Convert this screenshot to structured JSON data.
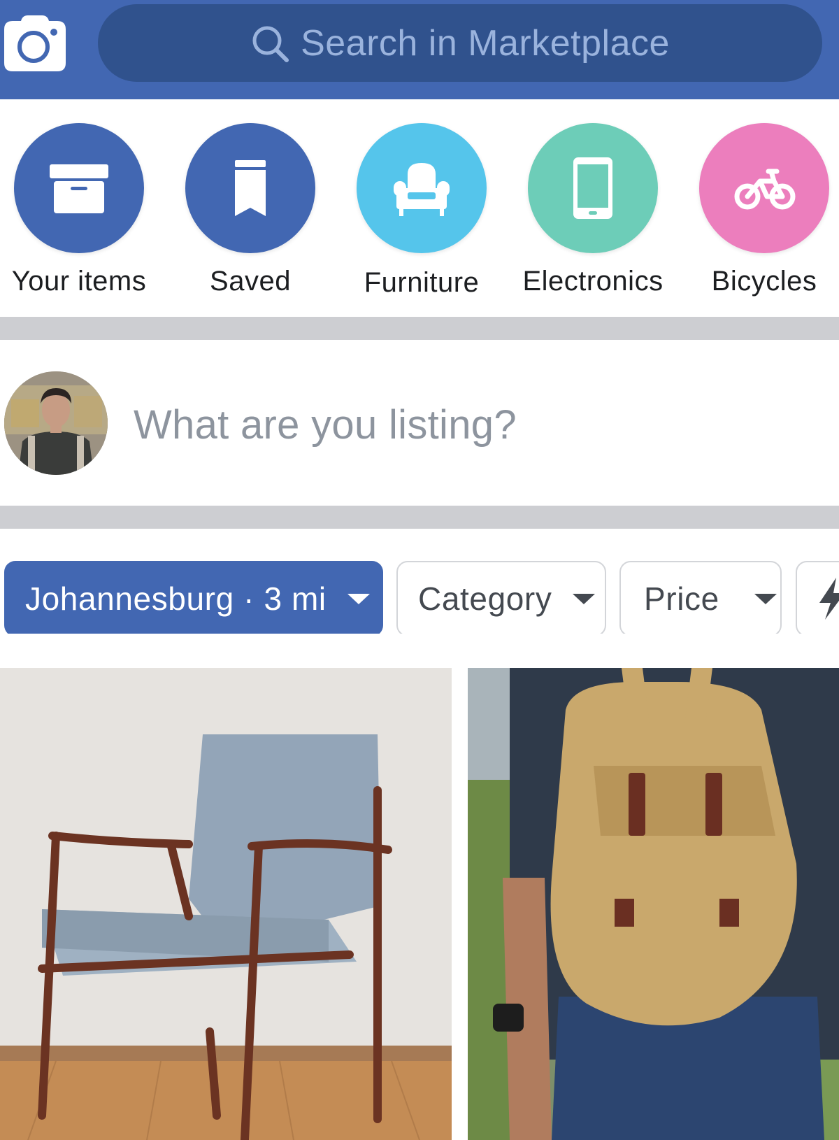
{
  "header": {
    "camera_icon": "camera-icon",
    "search": {
      "icon": "search-icon",
      "placeholder": "Search in Marketplace"
    },
    "brand_color": "#4267b2",
    "search_bg_color": "#30528d"
  },
  "shortcuts": [
    {
      "label": "Your items",
      "icon": "archive-box-icon",
      "color": "#4267b2"
    },
    {
      "label": "Saved",
      "icon": "bookmark-icon",
      "color": "#4267b2"
    },
    {
      "label": "Furniture",
      "icon": "armchair-icon",
      "color": "#55c5eb"
    },
    {
      "label": "Electronics",
      "icon": "smartphone-icon",
      "color": "#6dcdb8"
    },
    {
      "label": "Bicycles",
      "icon": "bicycle-icon",
      "color": "#ec7ebd"
    }
  ],
  "composer": {
    "avatar": "user-avatar",
    "prompt": "What are you listing?"
  },
  "filters": {
    "location": {
      "label": "Johannesburg · 3 mi",
      "icon": "caret-down-icon"
    },
    "category": {
      "label": "Category",
      "icon": "caret-down-icon"
    },
    "price": {
      "label": "Price",
      "icon": "caret-down-icon"
    },
    "quick": {
      "icon": "lightning-bolt-icon"
    }
  },
  "listings": [
    {
      "image": "mid-century wooden armchair with grey cushions"
    },
    {
      "image": "person wearing tan canvas backpack"
    }
  ]
}
